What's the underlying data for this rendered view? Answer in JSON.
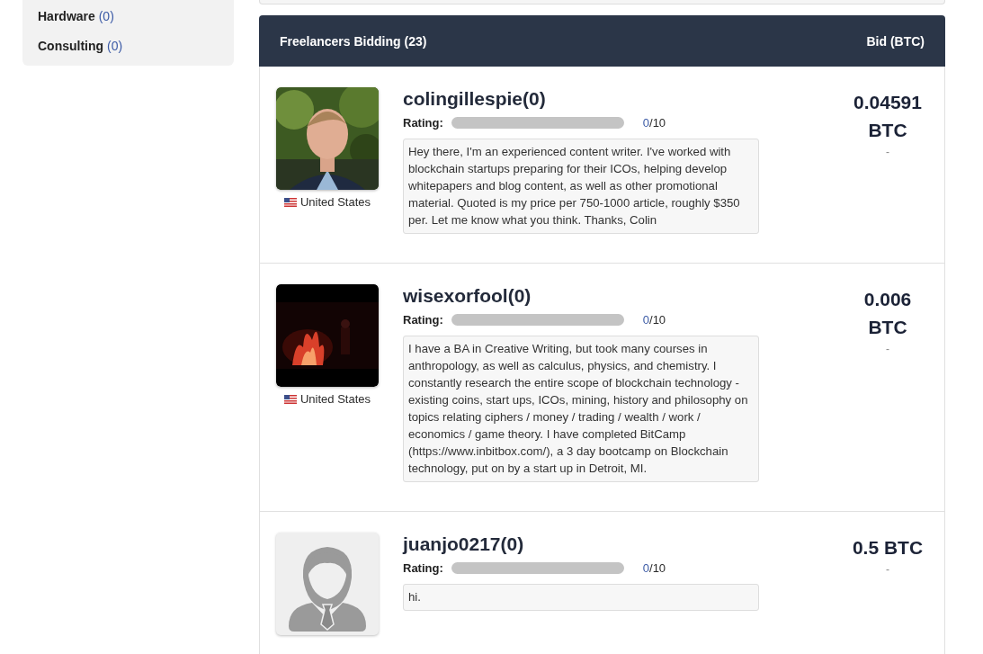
{
  "sidebar": {
    "categories": [
      {
        "name": "Hardware",
        "count": "(0)"
      },
      {
        "name": "Consulting",
        "count": "(0)"
      }
    ]
  },
  "bids": {
    "title": "Freelancers Bidding (23)",
    "bid_heading": "Bid (BTC)",
    "rows": [
      {
        "username": "colingillespie(0)",
        "country": "United States",
        "rating_label": "Rating:",
        "level": 0,
        "rating_score": "0",
        "rating_max": "/10",
        "message": "Hey there, I'm an experienced content writer. I've worked with blockchain startups preparing for their ICOs, helping develop whitepapers and blog content, as well as other promotional material. Quoted is my price per 750-1000 article, roughly $350 per. Let me know what you think. Thanks, Colin",
        "bid_amount": "0.04591",
        "bid_unit": "BTC",
        "bid_note": "-"
      },
      {
        "username": "wisexorfool(0)",
        "kind": "video",
        "country": "United States",
        "rating_label": "Rating:",
        "level": 0,
        "rating_score": "0",
        "rating_max": "/10",
        "message": "I have a BA in Creative Writing, but took many courses in anthropology, as well as calculus, physics, and chemistry. I constantly research the entire scope of blockchain technology - existing coins, start ups, ICOs, mining, history and philosophy on topics relating ciphers / money / trading / wealth / work / economics / game theory. I have completed BitCamp (https://www.inbitbox.com/), a 3 day bootcamp on Blockchain technology, put on by a start up in Detroit, MI.",
        "bid_amount": "0.006",
        "bid_unit": "BTC",
        "bid_note": "-"
      },
      {
        "username": "juanjo0217(0)",
        "kind": "default",
        "rating_label": "Rating:",
        "level": 0,
        "rating_score": "0",
        "rating_max": "/10",
        "message": "hi.",
        "bid_amount": "0.5",
        "bid_unit": "BTC",
        "bid_note": "-"
      }
    ]
  }
}
